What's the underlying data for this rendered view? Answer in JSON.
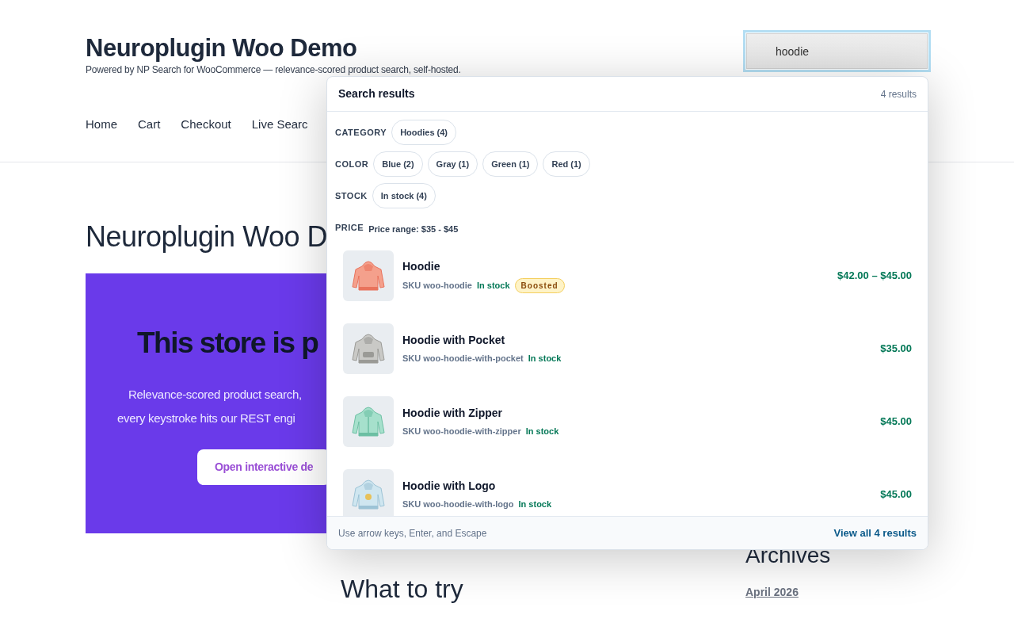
{
  "site": {
    "title": "Neuroplugin Woo Demo",
    "tagline": "Powered by NP Search for WooCommerce — relevance-scored product search, self-hosted."
  },
  "nav": [
    {
      "label": "Home"
    },
    {
      "label": "Cart"
    },
    {
      "label": "Checkout"
    },
    {
      "label": "Live Searc"
    }
  ],
  "search": {
    "value": "hoodie"
  },
  "page": {
    "title": "Neuroplugin Woo D",
    "hero": {
      "heading": "This store is p",
      "lines": [
        "Relevance-scored product search,",
        "every keystroke hits our REST engi"
      ],
      "button": "Open interactive de"
    },
    "section_title": "What to try"
  },
  "sidebar": {
    "title": "Archives",
    "links": [
      "April 2026"
    ]
  },
  "dropdown": {
    "title": "Search results",
    "count": "4 results",
    "facets": [
      {
        "label": "CATEGORY",
        "kind": "chips",
        "chips": [
          "Hoodies (4)"
        ]
      },
      {
        "label": "COLOR",
        "kind": "chips",
        "chips": [
          "Blue (2)",
          "Gray (1)",
          "Green (1)",
          "Red (1)"
        ]
      },
      {
        "label": "STOCK",
        "kind": "chips",
        "chips": [
          "In stock (4)"
        ]
      },
      {
        "label": "PRICE",
        "kind": "text",
        "text": "Price range: $35 - $45"
      }
    ],
    "results": [
      {
        "name": "Hoodie",
        "sku": "SKU woo-hoodie",
        "stock": "In stock",
        "badge": "Boosted",
        "price": "$42.00 – $45.00"
      },
      {
        "name": "Hoodie with Pocket",
        "sku": "SKU woo-hoodie-with-pocket",
        "stock": "In stock",
        "price": "$35.00"
      },
      {
        "name": "Hoodie with Zipper",
        "sku": "SKU woo-hoodie-with-zipper",
        "stock": "In stock",
        "price": "$45.00"
      },
      {
        "name": "Hoodie with Logo",
        "sku": "SKU woo-hoodie-with-logo",
        "stock": "In stock",
        "price": "$45.00"
      }
    ],
    "hint": "Use arrow keys, Enter, and Escape",
    "view_all": "View all 4 results"
  }
}
